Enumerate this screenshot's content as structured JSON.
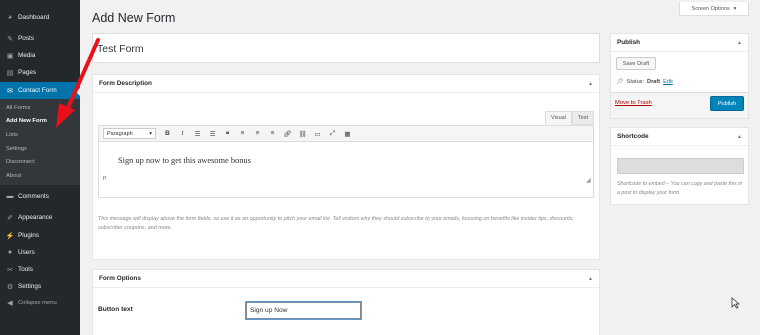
{
  "sidebar": {
    "items": [
      {
        "label": "Dashboard",
        "icon": "dashboard-icon"
      },
      {
        "label": "Posts",
        "icon": "pin-icon"
      },
      {
        "label": "Media",
        "icon": "media-icon"
      },
      {
        "label": "Pages",
        "icon": "pages-icon"
      },
      {
        "label": "Contact Form",
        "icon": "mail-icon"
      },
      {
        "label": "Comments",
        "icon": "comments-icon"
      },
      {
        "label": "Appearance",
        "icon": "brush-icon"
      },
      {
        "label": "Plugins",
        "icon": "plugin-icon"
      },
      {
        "label": "Users",
        "icon": "users-icon"
      },
      {
        "label": "Tools",
        "icon": "wrench-icon"
      },
      {
        "label": "Settings",
        "icon": "settings-icon"
      }
    ],
    "submenu": [
      "All Forms",
      "Add New Form",
      "Lists",
      "Settings",
      "Disconnect",
      "About"
    ],
    "collapse_label": "Collapse menu",
    "active_color": "#0073aa"
  },
  "header": {
    "title": "Add New Form",
    "screen_options": "Screen Options"
  },
  "form": {
    "title_value": "Test Form",
    "description": {
      "heading": "Form Description",
      "tab_visual": "Visual",
      "tab_text": "Text",
      "format_select": "Paragraph",
      "content": "Sign up now to get this awesome bonus",
      "path": "p",
      "help": "This message will display above the form fields, so use it as an opportunity to pitch your email list. Tell visitors why they should subscribe to your emails, focusing on benefits like insider tips, discounts, subscriber coupons, and more."
    },
    "options": {
      "heading": "Form Options",
      "button_text_label": "Button text",
      "button_text_value": "Sign up Now"
    }
  },
  "publish": {
    "heading": "Publish",
    "save_draft": "Save Draft",
    "status_label": "Status:",
    "status_value": "Draft",
    "edit_link": "Edit",
    "move_to_trash": "Move to Trash",
    "publish_button": "Publish",
    "button_color": "#0085ba"
  },
  "shortcode": {
    "heading": "Shortcode",
    "help": "Shortcode to embed – You can copy and paste this in a post to display your form."
  },
  "annotation": {
    "arrow_color": "#e8101a"
  }
}
